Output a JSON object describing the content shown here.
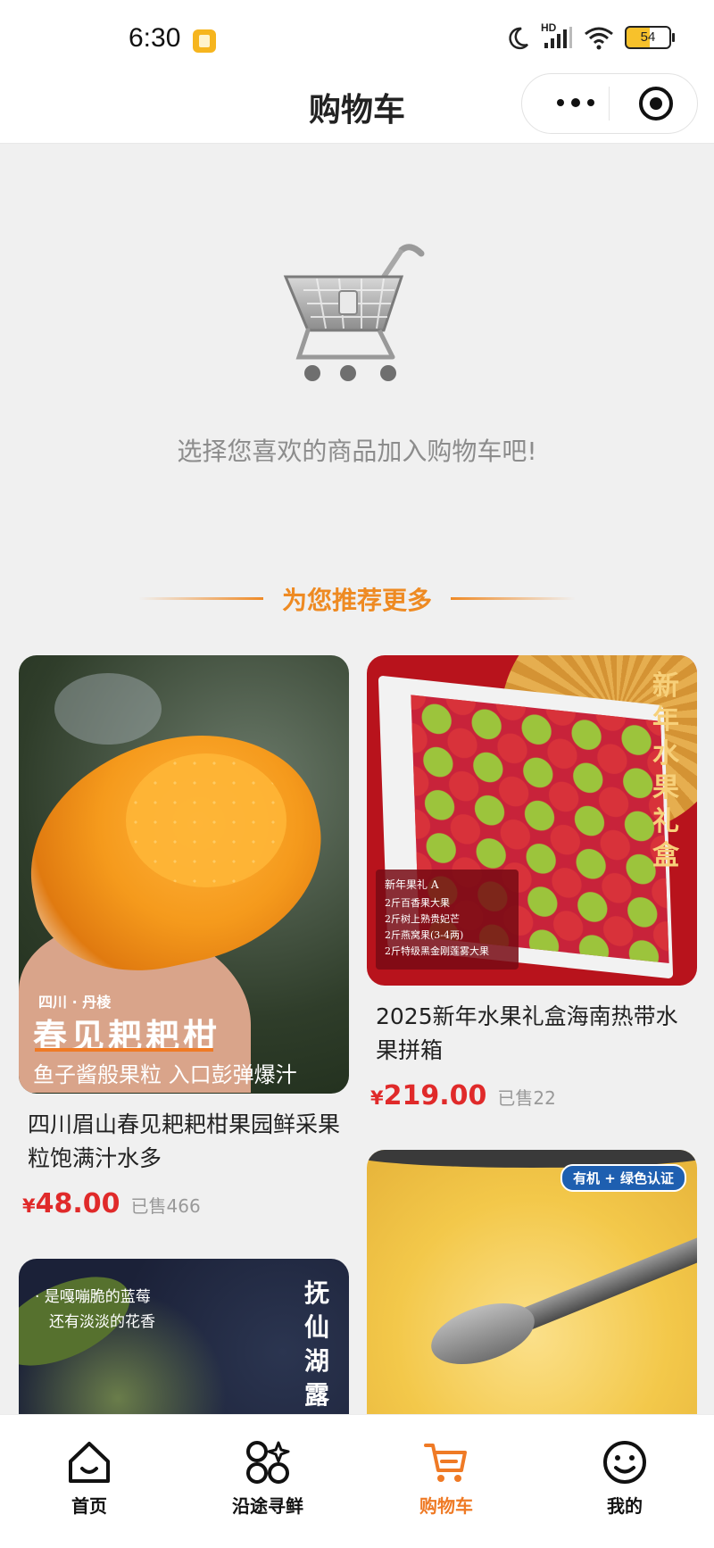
{
  "status": {
    "time": "6:30",
    "battery": "54",
    "network": "HD"
  },
  "nav": {
    "title": "购物车"
  },
  "empty": {
    "message": "选择您喜欢的商品加入购物车吧!"
  },
  "recommend": {
    "heading": "为您推荐更多"
  },
  "products": [
    {
      "title": "四川眉山春见耙耙柑果园鲜采果粒饱满汁水多",
      "currency": "¥",
      "price": "48.00",
      "sold": "已售466",
      "image_text": {
        "origin": "四川 · 丹棱",
        "name": "春见耙耙柑",
        "tagline": "鱼子酱般果粒 入口彭弹爆汁"
      }
    },
    {
      "title": "2025新年水果礼盒海南热带水果拼箱",
      "currency": "¥",
      "price": "219.00",
      "sold": "已售22",
      "image_text": {
        "vertical": "新年水果礼盒",
        "box_title": "新年果礼 A",
        "box_items": [
          "2斤百香果大果",
          "2斤树上熟贵妃芒",
          "2斤燕窝果(3-4两)",
          "2斤特级黑金刚莲雾大果"
        ]
      }
    },
    {
      "image_text": {
        "line1": "· 是嘎嘣脆的蓝莓",
        "line2": "还有淡淡的花香",
        "vertical": "抚仙湖露天"
      }
    },
    {
      "image_text": {
        "badge": "有机 + 绿色认证"
      }
    }
  ],
  "tabbar": {
    "items": [
      {
        "label": "首页",
        "icon": "home-icon",
        "active": false
      },
      {
        "label": "沿途寻鲜",
        "icon": "grid-icon",
        "active": false
      },
      {
        "label": "购物车",
        "icon": "cart-icon",
        "active": true
      },
      {
        "label": "我的",
        "icon": "smile-icon",
        "active": false
      }
    ]
  },
  "colors": {
    "accent": "#ef7a25",
    "price": "#e02a2a",
    "background": "#f0f0f0"
  }
}
